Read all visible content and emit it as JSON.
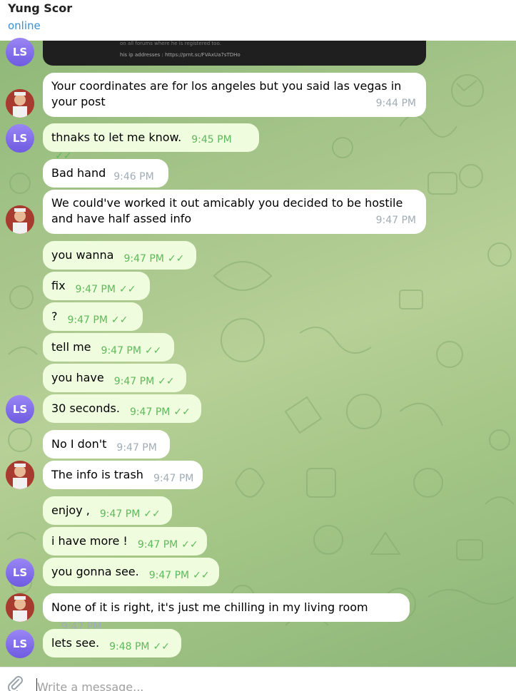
{
  "header": {
    "title": "Yung Scor",
    "status": "online"
  },
  "preview_image": {
    "line1": "on all forums where he is registered too.",
    "line2": "his ip addresses : https://prnt.sc/FVAxUa7sTDHo"
  },
  "avatars": {
    "ls": "LS"
  },
  "messages": [
    {
      "text": "Your coordinates are for los angeles but you said las vegas in your post",
      "time": "9:44 PM"
    },
    {
      "text": "thnaks to let me know.",
      "time": "9:45 PM"
    },
    {
      "text": "Bad hand",
      "time": "9:46 PM"
    },
    {
      "text": "We could've worked it out amicably you decided to be hostile and have half assed info",
      "time": "9:47 PM"
    },
    {
      "text": "you wanna",
      "time": "9:47 PM"
    },
    {
      "text": "fix",
      "time": "9:47 PM"
    },
    {
      "text": "?",
      "time": "9:47 PM"
    },
    {
      "text": "tell me",
      "time": "9:47 PM"
    },
    {
      "text": "you have",
      "time": "9:47 PM"
    },
    {
      "text": "30 seconds.",
      "time": "9:47 PM"
    },
    {
      "text": "No I don't",
      "time": "9:47 PM"
    },
    {
      "text": "The info is trash",
      "time": "9:47 PM"
    },
    {
      "text": "enjoy ,",
      "time": "9:47 PM"
    },
    {
      "text": "i have more !",
      "time": "9:47 PM"
    },
    {
      "text": "you gonna see.",
      "time": "9:47 PM"
    },
    {
      "text": "None of it is right, it's just me chilling in my living room",
      "time": "9:47 PM"
    },
    {
      "text": "lets see.",
      "time": "9:48 PM"
    }
  ],
  "composer": {
    "placeholder": "Write a message..."
  },
  "colors": {
    "outgoing_bubble": "#effdde",
    "incoming_bubble": "#ffffff",
    "check": "#5fb85b",
    "status": "#3a8fd6",
    "avatar_ls": "#7a66ea"
  }
}
